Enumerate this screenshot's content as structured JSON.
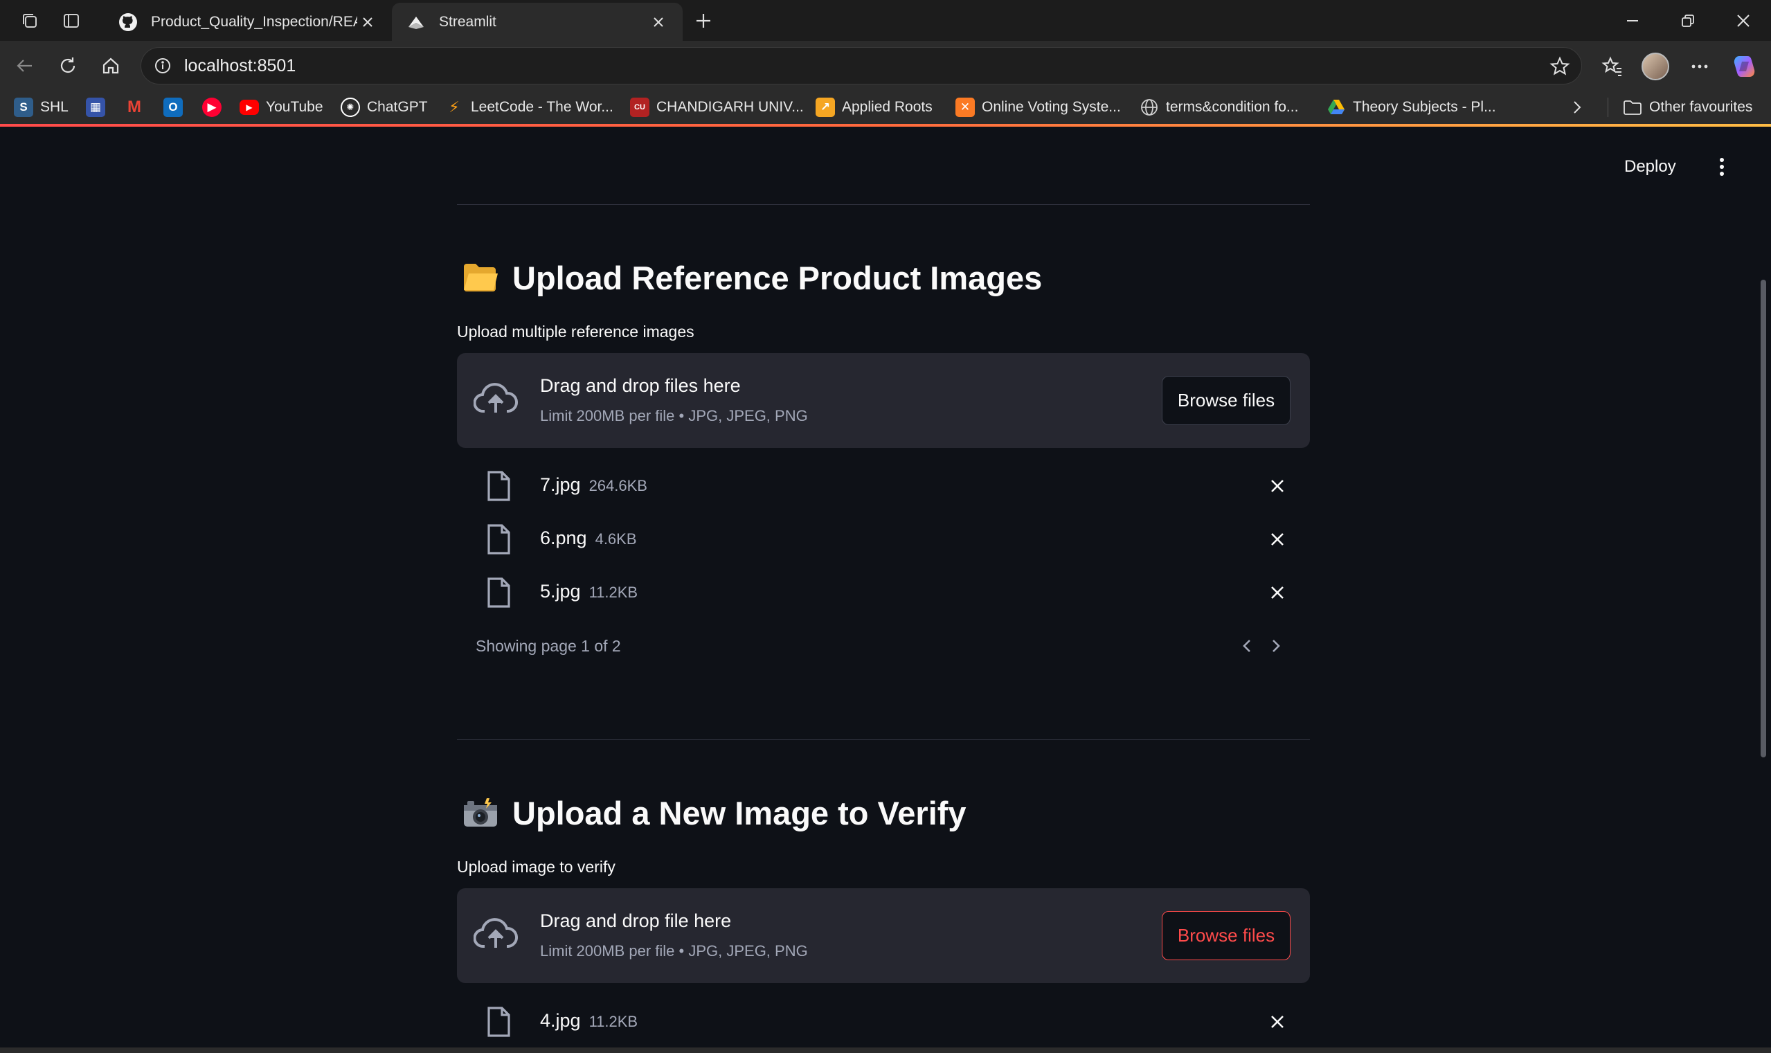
{
  "browser": {
    "tabs": [
      {
        "title": "Product_Quality_Inspection/README.md",
        "icon": "github-icon",
        "active": false
      },
      {
        "title": "Streamlit",
        "icon": "streamlit-icon",
        "active": true
      }
    ],
    "url": "localhost:8501",
    "bookmarks": [
      {
        "label": "SHL",
        "icon": "shl-icon",
        "color": "#2f5d8a"
      },
      {
        "label": "",
        "icon": "calendar-app-icon",
        "color": "#3553a8"
      },
      {
        "label": "",
        "icon": "gmail-icon",
        "color": "#ea4335"
      },
      {
        "label": "",
        "icon": "outlook-icon",
        "color": "#0f6cbd"
      },
      {
        "label": "",
        "icon": "youtube-music-icon",
        "color": "#ff0033"
      },
      {
        "label": "YouTube",
        "icon": "youtube-icon",
        "color": "#ff0000"
      },
      {
        "label": "ChatGPT",
        "icon": "chatgpt-icon",
        "color": "#ffffff"
      },
      {
        "label": "LeetCode - The Wor...",
        "icon": "leetcode-icon",
        "color": "#ffa116"
      },
      {
        "label": "CHANDIGARH UNIV...",
        "icon": "chandigarh-univ-icon",
        "color": "#b22222"
      },
      {
        "label": "Applied Roots",
        "icon": "applied-roots-icon",
        "color": "#f5a623"
      },
      {
        "label": "Online Voting Syste...",
        "icon": "xampp-icon",
        "color": "#fb7a24"
      },
      {
        "label": "terms&condition fo...",
        "icon": "globe-icon",
        "color": "#cccccc"
      },
      {
        "label": "Theory Subjects - Pl...",
        "icon": "google-drive-icon",
        "color": "#34a853"
      }
    ],
    "other_favourites": "Other favourites"
  },
  "app": {
    "deploy_label": "Deploy",
    "reference": {
      "title": "Upload Reference Product Images",
      "label": "Upload multiple reference images",
      "dropzone_title": "Drag and drop files here",
      "dropzone_sub": "Limit 200MB per file • JPG, JPEG, PNG",
      "browse_label": "Browse files",
      "files": [
        {
          "name": "7.jpg",
          "size": "264.6KB"
        },
        {
          "name": "6.png",
          "size": "4.6KB"
        },
        {
          "name": "5.jpg",
          "size": "11.2KB"
        }
      ],
      "pager": "Showing page 1 of 2"
    },
    "verify": {
      "title": "Upload a New Image to Verify",
      "label": "Upload image to verify",
      "dropzone_title": "Drag and drop file here",
      "dropzone_sub": "Limit 200MB per file • JPG, JPEG, PNG",
      "browse_label": "Browse files",
      "files": [
        {
          "name": "4.jpg",
          "size": "11.2KB"
        }
      ]
    },
    "colors": {
      "background": "#0e1117",
      "dropzone": "#262730",
      "accent": "#ff4b4b",
      "muted_text": "#a3a8b8"
    }
  }
}
